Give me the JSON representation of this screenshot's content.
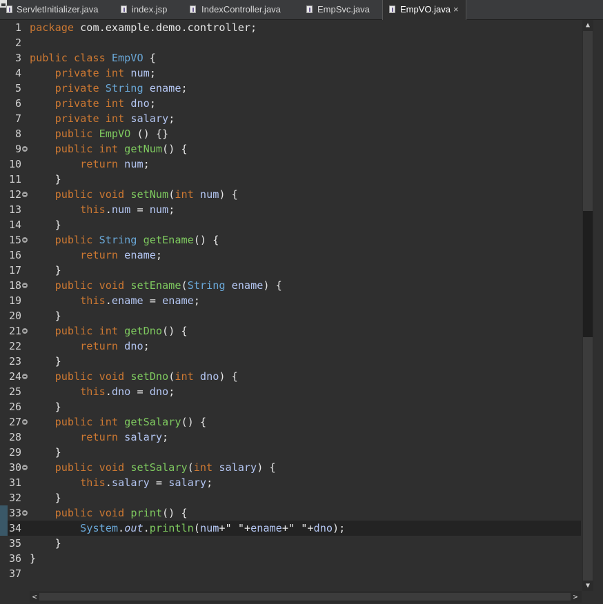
{
  "tabs": [
    {
      "label": "ServletInitializer.java",
      "icon": "java-file-icon",
      "active": false
    },
    {
      "label": "index.jsp",
      "icon": "jsp-file-icon",
      "active": false
    },
    {
      "label": "IndexController.java",
      "icon": "java-file-icon",
      "active": false
    },
    {
      "label": "EmpSvc.java",
      "icon": "java-file-icon",
      "active": false
    },
    {
      "label": "EmpVO.java",
      "icon": "java-file-icon",
      "active": true,
      "close": "×"
    }
  ],
  "window": {
    "minimize": "minimize",
    "maximize": "maximize"
  },
  "scroll": {
    "up": "▲",
    "down": "▼",
    "left": "<",
    "right": ">"
  },
  "lines": [
    {
      "n": "1",
      "t": [
        [
          "kw",
          "package"
        ],
        [
          "st",
          " com.example.demo.controller;"
        ]
      ]
    },
    {
      "n": "2",
      "t": []
    },
    {
      "n": "3",
      "t": [
        [
          "kw",
          "public class "
        ],
        [
          "ty",
          "EmpVO"
        ],
        [
          "st",
          " {"
        ]
      ]
    },
    {
      "n": "4",
      "t": [
        [
          "st",
          "    "
        ],
        [
          "kw",
          "private int "
        ],
        [
          "fd",
          "num"
        ],
        [
          "st",
          ";"
        ]
      ]
    },
    {
      "n": "5",
      "t": [
        [
          "st",
          "    "
        ],
        [
          "kw",
          "private "
        ],
        [
          "ty",
          "String "
        ],
        [
          "fd",
          "ename"
        ],
        [
          "st",
          ";"
        ]
      ]
    },
    {
      "n": "6",
      "t": [
        [
          "st",
          "    "
        ],
        [
          "kw",
          "private int "
        ],
        [
          "fd",
          "dno"
        ],
        [
          "st",
          ";"
        ]
      ]
    },
    {
      "n": "7",
      "t": [
        [
          "st",
          "    "
        ],
        [
          "kw",
          "private int "
        ],
        [
          "fd",
          "salary"
        ],
        [
          "st",
          ";"
        ]
      ]
    },
    {
      "n": "8",
      "t": [
        [
          "st",
          "    "
        ],
        [
          "kw",
          "public "
        ],
        [
          "fn",
          "EmpVO"
        ],
        [
          "st",
          " () {}"
        ]
      ]
    },
    {
      "n": "9",
      "fold": true,
      "t": [
        [
          "st",
          "    "
        ],
        [
          "kw",
          "public int "
        ],
        [
          "fn",
          "getNum"
        ],
        [
          "st",
          "() {"
        ]
      ]
    },
    {
      "n": "10",
      "t": [
        [
          "st",
          "        "
        ],
        [
          "kw",
          "return "
        ],
        [
          "fd",
          "num"
        ],
        [
          "st",
          ";"
        ]
      ]
    },
    {
      "n": "11",
      "t": [
        [
          "st",
          "    }"
        ]
      ]
    },
    {
      "n": "12",
      "fold": true,
      "t": [
        [
          "st",
          "    "
        ],
        [
          "kw",
          "public void "
        ],
        [
          "fn",
          "setNum"
        ],
        [
          "st",
          "("
        ],
        [
          "kw",
          "int "
        ],
        [
          "fd",
          "num"
        ],
        [
          "st",
          ") {"
        ]
      ]
    },
    {
      "n": "13",
      "t": [
        [
          "st",
          "        "
        ],
        [
          "kw",
          "this"
        ],
        [
          "st",
          "."
        ],
        [
          "fd",
          "num"
        ],
        [
          "st",
          " = "
        ],
        [
          "fd",
          "num"
        ],
        [
          "st",
          ";"
        ]
      ]
    },
    {
      "n": "14",
      "t": [
        [
          "st",
          "    }"
        ]
      ]
    },
    {
      "n": "15",
      "fold": true,
      "t": [
        [
          "st",
          "    "
        ],
        [
          "kw",
          "public "
        ],
        [
          "ty",
          "String "
        ],
        [
          "fn",
          "getEname"
        ],
        [
          "st",
          "() {"
        ]
      ]
    },
    {
      "n": "16",
      "t": [
        [
          "st",
          "        "
        ],
        [
          "kw",
          "return "
        ],
        [
          "fd",
          "ename"
        ],
        [
          "st",
          ";"
        ]
      ]
    },
    {
      "n": "17",
      "t": [
        [
          "st",
          "    }"
        ]
      ]
    },
    {
      "n": "18",
      "fold": true,
      "t": [
        [
          "st",
          "    "
        ],
        [
          "kw",
          "public void "
        ],
        [
          "fn",
          "setEname"
        ],
        [
          "st",
          "("
        ],
        [
          "ty",
          "String "
        ],
        [
          "fd",
          "ename"
        ],
        [
          "st",
          ") {"
        ]
      ]
    },
    {
      "n": "19",
      "t": [
        [
          "st",
          "        "
        ],
        [
          "kw",
          "this"
        ],
        [
          "st",
          "."
        ],
        [
          "fd",
          "ename"
        ],
        [
          "st",
          " = "
        ],
        [
          "fd",
          "ename"
        ],
        [
          "st",
          ";"
        ]
      ]
    },
    {
      "n": "20",
      "t": [
        [
          "st",
          "    }"
        ]
      ]
    },
    {
      "n": "21",
      "fold": true,
      "t": [
        [
          "st",
          "    "
        ],
        [
          "kw",
          "public int "
        ],
        [
          "fn",
          "getDno"
        ],
        [
          "st",
          "() {"
        ]
      ]
    },
    {
      "n": "22",
      "t": [
        [
          "st",
          "        "
        ],
        [
          "kw",
          "return "
        ],
        [
          "fd",
          "dno"
        ],
        [
          "st",
          ";"
        ]
      ]
    },
    {
      "n": "23",
      "t": [
        [
          "st",
          "    }"
        ]
      ]
    },
    {
      "n": "24",
      "fold": true,
      "t": [
        [
          "st",
          "    "
        ],
        [
          "kw",
          "public void "
        ],
        [
          "fn",
          "setDno"
        ],
        [
          "st",
          "("
        ],
        [
          "kw",
          "int "
        ],
        [
          "fd",
          "dno"
        ],
        [
          "st",
          ") {"
        ]
      ]
    },
    {
      "n": "25",
      "t": [
        [
          "st",
          "        "
        ],
        [
          "kw",
          "this"
        ],
        [
          "st",
          "."
        ],
        [
          "fd",
          "dno"
        ],
        [
          "st",
          " = "
        ],
        [
          "fd",
          "dno"
        ],
        [
          "st",
          ";"
        ]
      ]
    },
    {
      "n": "26",
      "t": [
        [
          "st",
          "    }"
        ]
      ]
    },
    {
      "n": "27",
      "fold": true,
      "t": [
        [
          "st",
          "    "
        ],
        [
          "kw",
          "public int "
        ],
        [
          "fn",
          "getSalary"
        ],
        [
          "st",
          "() {"
        ]
      ]
    },
    {
      "n": "28",
      "t": [
        [
          "st",
          "        "
        ],
        [
          "kw",
          "return "
        ],
        [
          "fd",
          "salary"
        ],
        [
          "st",
          ";"
        ]
      ]
    },
    {
      "n": "29",
      "t": [
        [
          "st",
          "    }"
        ]
      ]
    },
    {
      "n": "30",
      "fold": true,
      "t": [
        [
          "st",
          "    "
        ],
        [
          "kw",
          "public void "
        ],
        [
          "fn",
          "setSalary"
        ],
        [
          "st",
          "("
        ],
        [
          "kw",
          "int "
        ],
        [
          "fd",
          "salary"
        ],
        [
          "st",
          ") {"
        ]
      ]
    },
    {
      "n": "31",
      "t": [
        [
          "st",
          "        "
        ],
        [
          "kw",
          "this"
        ],
        [
          "st",
          "."
        ],
        [
          "fd",
          "salary"
        ],
        [
          "st",
          " = "
        ],
        [
          "fd",
          "salary"
        ],
        [
          "st",
          ";"
        ]
      ]
    },
    {
      "n": "32",
      "t": [
        [
          "st",
          "    }"
        ]
      ]
    },
    {
      "n": "33",
      "fold": true,
      "marker": true,
      "t": [
        [
          "st",
          "    "
        ],
        [
          "kw",
          "public void "
        ],
        [
          "fn",
          "print"
        ],
        [
          "st",
          "() {"
        ]
      ]
    },
    {
      "n": "34",
      "current": true,
      "marker": true,
      "t": [
        [
          "st",
          "        "
        ],
        [
          "ty",
          "System"
        ],
        [
          "st",
          "."
        ],
        [
          "fd it",
          "out"
        ],
        [
          "st",
          "."
        ],
        [
          "fn",
          "println"
        ],
        [
          "st",
          "("
        ],
        [
          "fd",
          "num"
        ],
        [
          "st",
          "+\" \"+"
        ],
        [
          "fd",
          "ename"
        ],
        [
          "st",
          "+\" \"+"
        ],
        [
          "fd",
          "dno"
        ],
        [
          "st",
          ");"
        ]
      ]
    },
    {
      "n": "35",
      "t": [
        [
          "st",
          "    }"
        ]
      ]
    },
    {
      "n": "36",
      "t": [
        [
          "st",
          "}"
        ]
      ]
    },
    {
      "n": "37",
      "t": []
    }
  ],
  "colors": {
    "keyword": "#cc7832",
    "type": "#6aa8d8",
    "method": "#7ec95f",
    "field": "#b4c6f2",
    "text": "#e6e6e6",
    "background": "#2f2f2f"
  }
}
